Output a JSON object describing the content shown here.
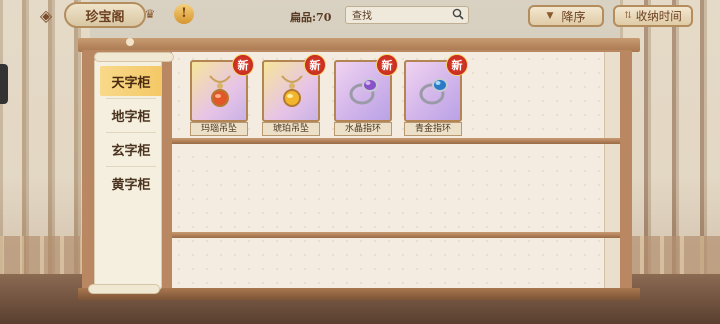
{
  "header": {
    "back_icon": "back-arrow-icon",
    "title": "珍宝阁",
    "capacity": "扁品:70",
    "search_placeholder": "查找",
    "sort_label": "降序",
    "time_label": "收纳时间"
  },
  "tabs": [
    {
      "label": "天字柜",
      "active": true
    },
    {
      "label": "地字柜",
      "active": false
    },
    {
      "label": "玄字柜",
      "active": false
    },
    {
      "label": "黄字柜",
      "active": false
    }
  ],
  "items": [
    {
      "name": "玛瑙吊坠",
      "badge": "新",
      "icon": "agate-pendant-icon"
    },
    {
      "name": "琥珀吊坠",
      "badge": "新",
      "icon": "amber-pendant-icon"
    },
    {
      "name": "水晶指环",
      "badge": "新",
      "icon": "crystal-ring-icon"
    },
    {
      "name": "青金指环",
      "badge": "新",
      "icon": "lapis-ring-icon"
    }
  ],
  "colors": {
    "active_tab": "#f4c866",
    "new_badge": "#d2321f",
    "frame": "#b98762"
  }
}
